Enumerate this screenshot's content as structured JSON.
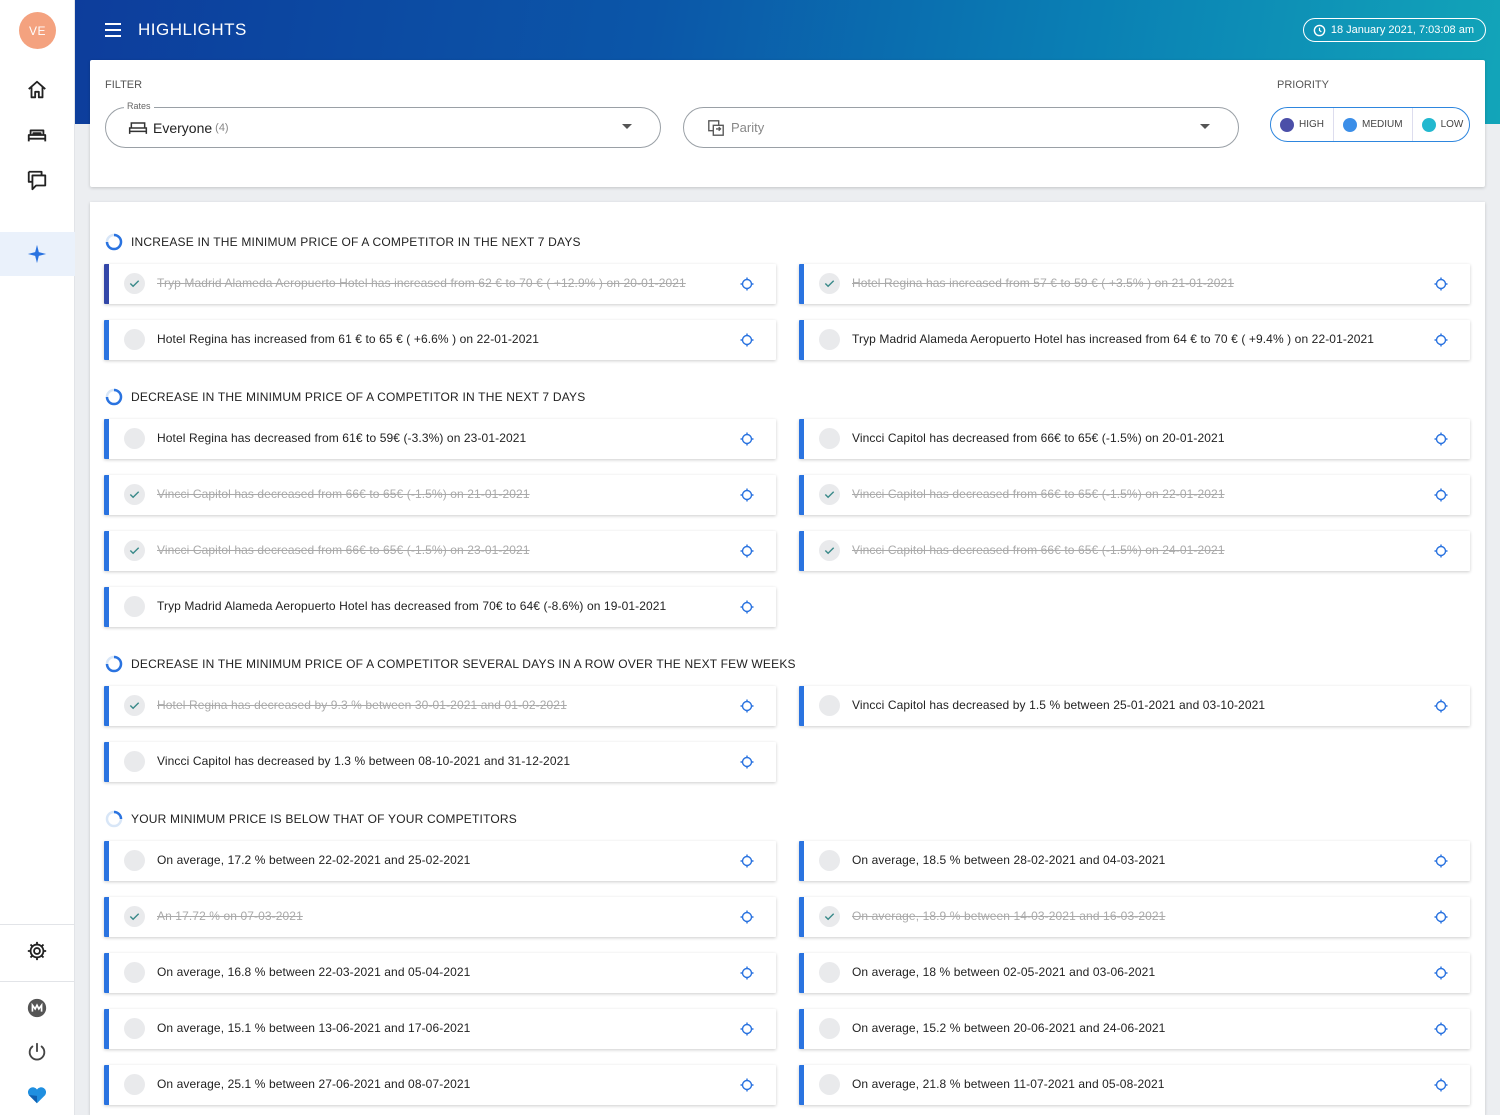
{
  "sidebar": {
    "avatar_initials": "VE",
    "top_icons": [
      "home-icon",
      "bed-icon",
      "chat-icon",
      "sparkle-icon"
    ],
    "bottom_icons": [
      "gear-icon",
      "m-logo-icon",
      "power-icon",
      "heart-logo-icon"
    ]
  },
  "header": {
    "title": "HIGHLIGHTS",
    "datetime": "18 January 2021, 7:03:08 am"
  },
  "filter": {
    "label": "FILTER",
    "rates_legend": "Rates",
    "rates_value": "Everyone",
    "rates_count": "(4)",
    "parity_placeholder": "Parity",
    "priority_label": "PRIORITY",
    "priorities": [
      {
        "label": "HIGH",
        "color": "#4b4fa8"
      },
      {
        "label": "MEDIUM",
        "color": "#3b8ee8"
      },
      {
        "label": "LOW",
        "color": "#22b8cf"
      }
    ]
  },
  "sections": [
    {
      "title": "INCREASE IN THE MINIMUM PRICE OF A COMPETITOR IN THE NEXT 7 DAYS",
      "items": [
        {
          "text": "Tryp Madrid Alameda Aeropuerto Hotel has increased from 62 € to 70 € ( +12.9% ) on 20-01-2021",
          "done": true
        },
        {
          "text": "Hotel Regina has increased from 57 € to 59 € ( +3.5% ) on 21-01-2021",
          "done": true
        },
        {
          "text": "Hotel Regina has increased from 61 € to 65 € ( +6.6% ) on 22-01-2021",
          "done": false
        },
        {
          "text": "Tryp Madrid Alameda Aeropuerto Hotel has increased from 64 € to 70 € ( +9.4% ) on 22-01-2021",
          "done": false
        }
      ]
    },
    {
      "title": "DECREASE IN THE MINIMUM PRICE OF A COMPETITOR IN THE NEXT 7 DAYS",
      "items": [
        {
          "text": "Hotel Regina has decreased from 61€ to 59€ (-3.3%) on 23-01-2021",
          "done": false
        },
        {
          "text": "Vincci Capitol has decreased from 66€ to 65€ (-1.5%) on 20-01-2021",
          "done": false
        },
        {
          "text": "Vincci Capitol has decreased from 66€ to 65€ (-1.5%) on 21-01-2021",
          "done": true
        },
        {
          "text": "Vincci Capitol has decreased from 66€ to 65€ (-1.5%) on 22-01-2021",
          "done": true
        },
        {
          "text": "Vincci Capitol has decreased from 66€ to 65€ (-1.5%) on 23-01-2021",
          "done": true
        },
        {
          "text": "Vincci Capitol has decreased from 66€ to 65€ (-1.5%) on 24-01-2021",
          "done": true
        },
        {
          "text": "Tryp Madrid Alameda Aeropuerto Hotel has decreased from 70€ to 64€ (-8.6%) on 19-01-2021",
          "done": false
        }
      ]
    },
    {
      "title": "DECREASE IN THE MINIMUM PRICE OF A COMPETITOR SEVERAL DAYS IN A ROW OVER THE NEXT FEW WEEKS",
      "items": [
        {
          "text": "Hotel Regina has decreased by 9.3 % between 30-01-2021 and 01-02-2021",
          "done": true
        },
        {
          "text": "Vincci Capitol has decreased by 1.5 % between 25-01-2021 and 03-10-2021",
          "done": false
        },
        {
          "text": "Vincci Capitol has decreased by 1.3 % between 08-10-2021 and 31-12-2021",
          "done": false
        }
      ]
    },
    {
      "title": "YOUR MINIMUM PRICE IS BELOW THAT OF YOUR COMPETITORS",
      "items": [
        {
          "text": "On average, 17.2 % between 22-02-2021 and 25-02-2021",
          "done": false
        },
        {
          "text": "On average, 18.5 % between 28-02-2021 and 04-03-2021",
          "done": false
        },
        {
          "text": "An 17.72 % on 07-03-2021",
          "done": true
        },
        {
          "text": "On average, 18.9 % between 14-03-2021 and 16-03-2021",
          "done": true
        },
        {
          "text": "On average, 16.8 % between 22-03-2021 and 05-04-2021",
          "done": false
        },
        {
          "text": "On average, 18 % between 02-05-2021 and 03-06-2021",
          "done": false
        },
        {
          "text": "On average, 15.1 % between 13-06-2021 and 17-06-2021",
          "done": false
        },
        {
          "text": "On average, 15.2 % between 20-06-2021 and 24-06-2021",
          "done": false
        },
        {
          "text": "On average, 25.1 % between 27-06-2021 and 08-07-2021",
          "done": false
        },
        {
          "text": "On average, 21.8 % between 11-07-2021 and 05-08-2021",
          "done": false
        }
      ]
    }
  ]
}
